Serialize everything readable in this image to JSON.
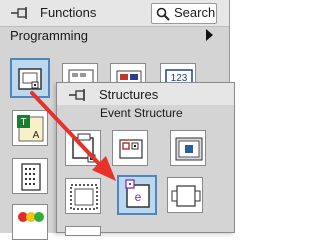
{
  "window": {
    "title": "Functions",
    "search_label": "Search",
    "category": "Programming"
  },
  "popup": {
    "title": "Structures",
    "subtitle": "Event Structure"
  },
  "icons": {
    "pin": "pin-icon",
    "search": "magnifier-icon",
    "submenu": "triangle-right-icon",
    "event_node": "e"
  },
  "colors": {
    "selection": "#bcd8ef",
    "selection_border": "#4e86bd",
    "arrow": "#e8312a",
    "event_glyph": "#7b2fb5"
  }
}
